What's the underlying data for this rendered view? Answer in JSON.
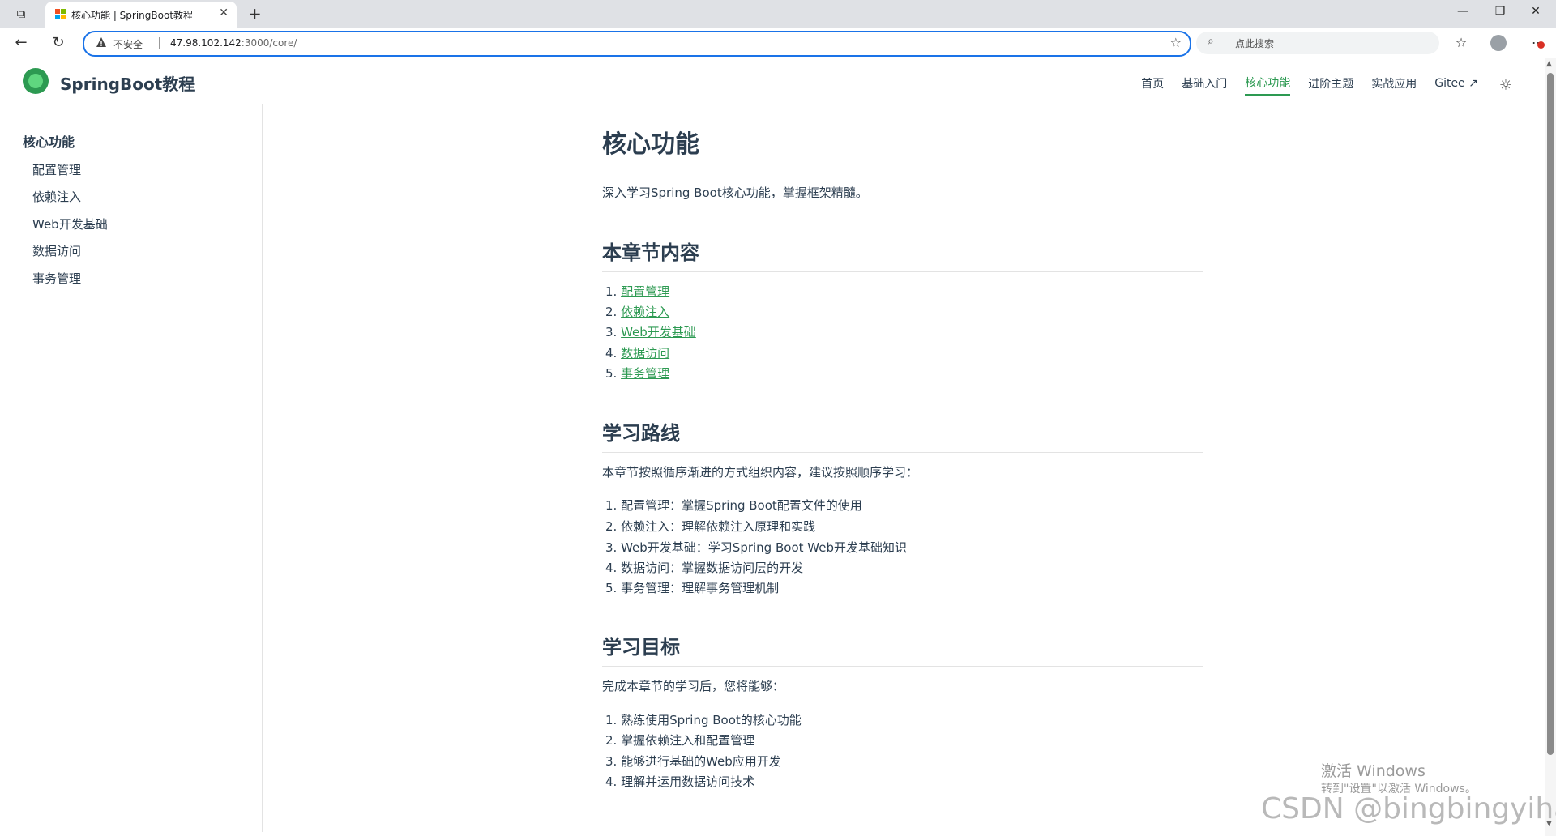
{
  "browser": {
    "tab_title": "核心功能 | SpringBoot教程",
    "insecure_label": "不安全",
    "url_host": "47.98.102.142",
    "url_rest": ":3000/core/",
    "search_placeholder": "点此搜索"
  },
  "site": {
    "title": "SpringBoot教程",
    "nav": [
      "首页",
      "基础入门",
      "核心功能",
      "进阶主题",
      "实战应用",
      "Gitee ↗"
    ],
    "active_nav": "核心功能"
  },
  "sidebar": {
    "heading": "核心功能",
    "items": [
      "配置管理",
      "依赖注入",
      "Web开发基础",
      "数据访问",
      "事务管理"
    ]
  },
  "main": {
    "title": "核心功能",
    "description": "深入学习Spring Boot核心功能，掌握框架精髓。",
    "section1": {
      "title": "本章节内容",
      "links": [
        "配置管理",
        "依赖注入",
        "Web开发基础",
        "数据访问",
        "事务管理"
      ]
    },
    "section2": {
      "title": "学习路线",
      "intro": "本章节按照循序渐进的方式组织内容，建议按照顺序学习：",
      "items": [
        "配置管理：掌握Spring Boot配置文件的使用",
        "依赖注入：理解依赖注入原理和实践",
        "Web开发基础：学习Spring Boot Web开发基础知识",
        "数据访问：掌握数据访问层的开发",
        "事务管理：理解事务管理机制"
      ]
    },
    "section3": {
      "title": "学习目标",
      "intro": "完成本章节的学习后，您将能够：",
      "items": [
        "熟练使用Spring Boot的核心功能",
        "掌握依赖注入和配置管理",
        "能够进行基础的Web应用开发",
        "理解并运用数据访问技术"
      ]
    }
  },
  "overlay": {
    "activate_title": "激活 Windows",
    "activate_sub": "转到\"设置\"以激活 Windows。",
    "csdn": "CSDN @bingbingyihao"
  },
  "colors": {
    "accent": "#2d9a52",
    "text": "#2c3e50"
  }
}
